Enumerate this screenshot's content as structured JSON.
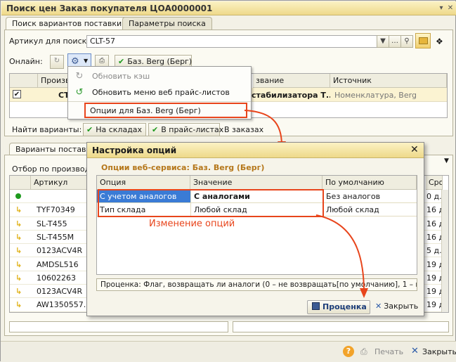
{
  "window": {
    "title": "Поиск цен Заказ покупателя ЦОА0000001"
  },
  "tabs": [
    {
      "label": "Поиск вариантов поставки",
      "active": true
    },
    {
      "label": "Параметры поиска",
      "active": false
    }
  ],
  "search": {
    "article_label": "Артикул для поиска:",
    "article_value": "CLT-57",
    "online_label": "Онлайн:",
    "online_source_chip": "Баз. Berg (Берг)"
  },
  "upper_grid": {
    "headers": [
      "Произво",
      "звание",
      "Источник"
    ],
    "row": {
      "checked": true,
      "producer": "СТ",
      "name": "стабилизатора Т...",
      "source": "Номенклатура, Berg"
    }
  },
  "menu": {
    "items": [
      {
        "label": "Обновить кэш",
        "icon": "refresh-cache-icon",
        "disabled": true
      },
      {
        "label": "Обновить меню веб прайс-листов",
        "icon": "refresh-arrows-icon",
        "disabled": false
      },
      {
        "label": "Опции для Баз. Berg (Берг)",
        "icon": "",
        "disabled": false,
        "highlighted": true
      }
    ]
  },
  "find": {
    "label": "Найти варианты:",
    "in_stock": "На складах",
    "in_pricelists": "В прайс-листах",
    "in_orders": "В заказах"
  },
  "lower": {
    "tab_label": "Варианты поставки",
    "filter_label": "Отбор по производит",
    "article_header": "Артикул",
    "right_header": "Сро",
    "articles": [
      "",
      "TYF70349",
      "SL-T455",
      "SL-T455M",
      "0123ACV4R",
      "AMDSL516",
      "10602263",
      "0123ACV4R",
      "AW1350557..."
    ],
    "terms": [
      "0 д...",
      "16 д",
      "16 д",
      "16 д",
      "5 д...",
      "19 д",
      "19 д",
      "19 д",
      "19 д"
    ]
  },
  "dialog": {
    "title": "Настройка опций",
    "subtitle": "Опции веб-сервиса: Баз. Berg (Берг)",
    "headers": [
      "Опция",
      "Значение",
      "По умолчанию"
    ],
    "rows": [
      {
        "option": "С учетом аналогов",
        "value": "С аналогами",
        "default": "Без аналогов"
      },
      {
        "option": "Тип склада",
        "value": "Любой склад",
        "default": "Любой склад"
      }
    ],
    "annotation": "Изменение опций",
    "hint": "Проценка: Флаг, возвращать ли аналоги (0 – не возвращать[по умолчанию], 1 – возвр...",
    "price_button": "Проценка",
    "close_button": "Закрыть"
  },
  "footer": {
    "print_label": "Печать",
    "close_label": "Закрыть"
  },
  "colors": {
    "accent_red": "#e8451c",
    "title_gold": "#eed98a",
    "check_green": "#1e9a1e"
  }
}
